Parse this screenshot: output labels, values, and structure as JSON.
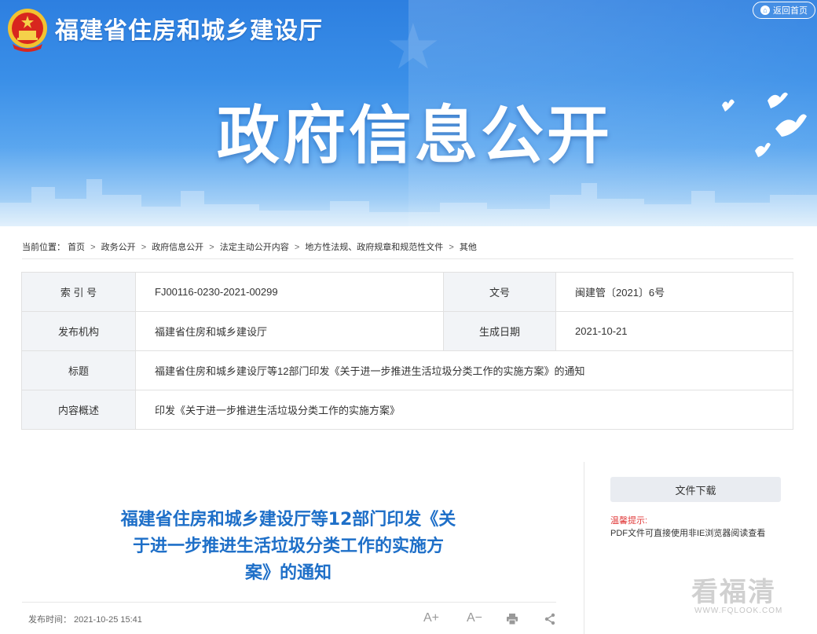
{
  "header": {
    "site_title": "福建省住房和城乡建设厅",
    "home_button": "返回首页",
    "hero_title": "政府信息公开"
  },
  "breadcrumb": {
    "prefix": "当前位置：",
    "items": [
      "首页",
      "政务公开",
      "政府信息公开",
      "法定主动公开内容",
      "地方性法规、政府规章和规范性文件",
      "其他"
    ],
    "separator": ">"
  },
  "info": {
    "index_label": "索 引 号",
    "index_value": "FJ00116-0230-2021-00299",
    "docno_label": "文号",
    "docno_value": "闽建管〔2021〕6号",
    "org_label": "发布机构",
    "org_value": "福建省住房和城乡建设厅",
    "date_label": "生成日期",
    "date_value": "2021-10-21",
    "title_label": "标题",
    "title_value": "福建省住房和城乡建设厅等12部门印发《关于进一步推进生活垃圾分类工作的实施方案》的通知",
    "summary_label": "内容概述",
    "summary_value": "印发《关于进一步推进生活垃圾分类工作的实施方案》"
  },
  "article": {
    "title_lines": [
      "福建省住房和城乡建设厅等12部门印发《关",
      "于进一步推进生活垃圾分类工作的实施方",
      "案》的通知"
    ],
    "pubtime": "发布时间：  2021-10-25 15:41",
    "tools": {
      "font_increase": "A+",
      "font_decrease": "A−"
    }
  },
  "sidebar": {
    "download_label": "文件下载",
    "tip_head": "温馨提示:",
    "tip_body": "PDF文件可直接使用非IE浏览器阅读查看"
  },
  "watermark": {
    "main": "看福清",
    "sub": "WWW.FQLOOK.COM"
  },
  "colors": {
    "banner_blue": "#3a8fe8",
    "title_blue": "#1e6fc8",
    "tip_red": "#e03a3a",
    "label_bg": "#f2f4f7"
  }
}
